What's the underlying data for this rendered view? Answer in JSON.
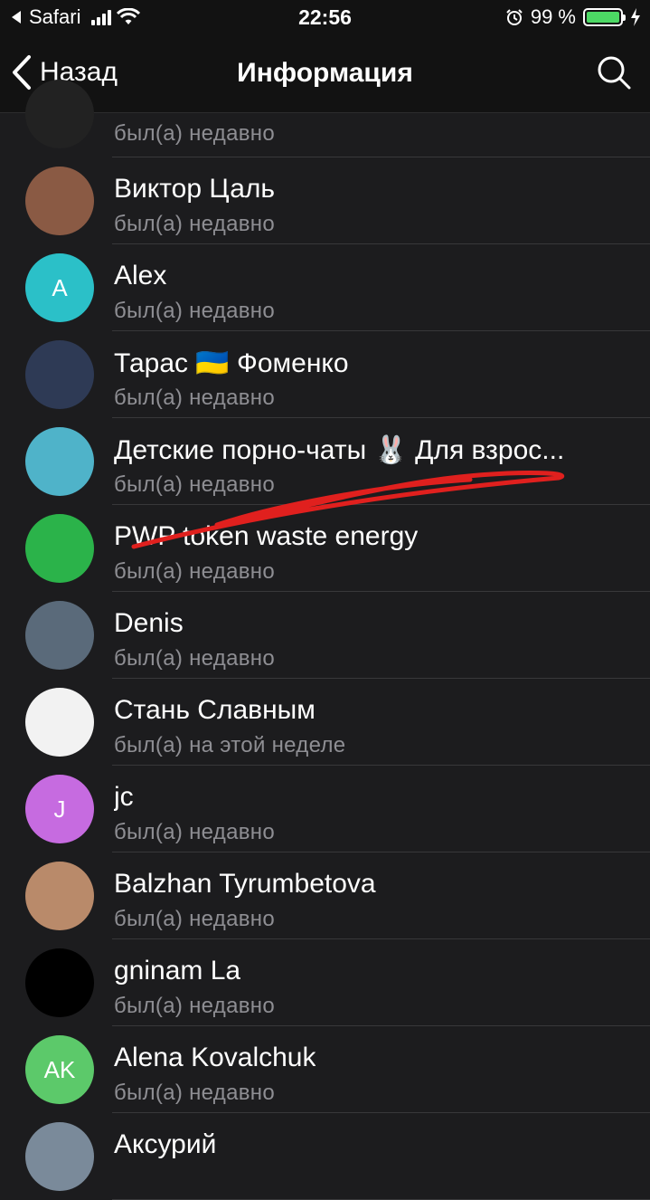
{
  "status_bar": {
    "carrier": "Safari",
    "time": "22:56",
    "battery": "99 %",
    "battery_level": 0.99
  },
  "nav": {
    "back_label": "Назад",
    "title": "Информация"
  },
  "members": [
    {
      "name": "",
      "status": "был(а) недавно",
      "avatar_color": "#222222",
      "initials": ""
    },
    {
      "name": "Виктор Цаль",
      "status": "был(а) недавно",
      "avatar_color": "#8a5a44",
      "initials": ""
    },
    {
      "name": "Alex",
      "status": "был(а) недавно",
      "avatar_color": "#2bc0c8",
      "initials": "A"
    },
    {
      "name": "Тарас 🇺🇦 Фоменко",
      "status": "был(а) недавно",
      "avatar_color": "#2e3a55",
      "initials": ""
    },
    {
      "name": "Детские порно-чаты 🐰 Для взрос...",
      "status": "был(а) недавно",
      "avatar_color": "#4fb3c9",
      "initials": ""
    },
    {
      "name": "PWP token waste energy",
      "status": "был(а) недавно",
      "avatar_color": "#2bb34a",
      "initials": ""
    },
    {
      "name": "Denis",
      "status": "был(а) недавно",
      "avatar_color": "#5a6a7a",
      "initials": ""
    },
    {
      "name": "Стань Славным",
      "status": "был(а) на этой неделе",
      "avatar_color": "#f2f2f2",
      "initials": ""
    },
    {
      "name": "jc",
      "status": "был(а) недавно",
      "avatar_color": "#c66be0",
      "initials": "J"
    },
    {
      "name": "Balzhan Tyrumbetova",
      "status": "был(а) недавно",
      "avatar_color": "#b98a6a",
      "initials": ""
    },
    {
      "name": "gninam La",
      "status": "был(а) недавно",
      "avatar_color": "#000000",
      "initials": ""
    },
    {
      "name": "Alena Kovalchuk",
      "status": "был(а) недавно",
      "avatar_color": "#5cc96a",
      "initials": "AK"
    },
    {
      "name": "Аксурий",
      "status": "",
      "avatar_color": "#7a8a9a",
      "initials": ""
    }
  ]
}
